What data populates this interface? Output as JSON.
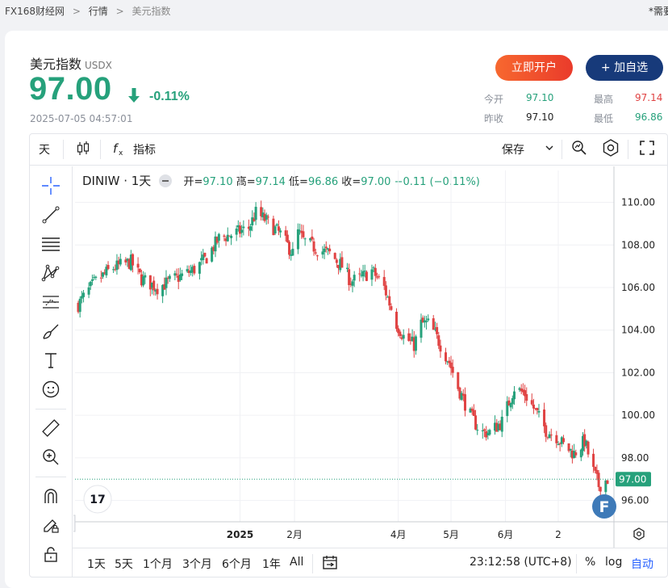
{
  "breadcrumb": {
    "home": "FX168财经网",
    "sep": ">",
    "section": "行情",
    "current": "美元指数",
    "right_text": "*需要"
  },
  "quote": {
    "name": "美元指数",
    "code": "USDX",
    "price": "97.00",
    "change_pct": "-0.11%",
    "direction": "down",
    "timestamp": "2025-07-05 04:57:01",
    "open_label": "今开",
    "open": "97.10",
    "high_label": "最高",
    "high": "97.14",
    "prev_label": "昨收",
    "prev": "97.10",
    "low_label": "最低",
    "low": "96.86"
  },
  "buttons": {
    "open_account": "立即开户",
    "add_watch": "+ 加自选"
  },
  "toolbar": {
    "interval": "天",
    "indicators": "指标",
    "save": "保存"
  },
  "legend": {
    "symbol": "DINIW · 1天",
    "open_label": "开",
    "open": "97.10",
    "high_label": "高",
    "high": "97.14",
    "low_label": "低",
    "low": "96.86",
    "close_label": "收",
    "close": "97.00",
    "change": "−0.11 (−0.11%)"
  },
  "bottombar": {
    "ranges": [
      "1天",
      "5天",
      "1个月",
      "3个月",
      "6个月",
      "1年",
      "All"
    ],
    "time": "23:12:58 (UTC+8)",
    "pct": "%",
    "log": "log",
    "auto": "自动"
  },
  "colors": {
    "up": "#26a17b",
    "down": "#e04343",
    "accent": "#2962ff",
    "brand_dark": "#173a7a"
  },
  "icons": [
    "crosshair-icon",
    "trend-line-icon",
    "fib-icon",
    "pattern-icon",
    "projection-icon",
    "brush-icon",
    "text-icon",
    "emoji-icon",
    "ruler-icon",
    "zoom-in-icon",
    "magnet-icon",
    "lock-draw-icon",
    "lock-icon",
    "candles-icon",
    "fx-icon",
    "camera-icon",
    "settings-icon",
    "fullscreen-icon",
    "tradingview-logo",
    "fx168-logo",
    "gear-icon",
    "calendar-range-icon"
  ],
  "chart_data": {
    "type": "candlestick",
    "symbol": "DINIW",
    "interval": "1天",
    "ylim": [
      95.0,
      111.5
    ],
    "yticks": [
      "110.00",
      "108.00",
      "106.00",
      "104.00",
      "102.00",
      "100.00",
      "98.00",
      "96.00"
    ],
    "xticks": [
      "2025",
      "2月",
      "4月",
      "5月",
      "6月",
      "2"
    ],
    "last_price_label": "97.00",
    "grid": true,
    "close_path": [
      [
        "2024-10-01",
        105.2
      ],
      [
        "2024-10-10",
        106.2
      ],
      [
        "2024-10-20",
        106.9
      ],
      [
        "2024-10-31",
        107.2
      ],
      [
        "2024-11-06",
        106.4
      ],
      [
        "2024-11-15",
        106.0
      ],
      [
        "2024-11-25",
        106.4
      ],
      [
        "2024-12-05",
        106.8
      ],
      [
        "2024-12-12",
        107.3
      ],
      [
        "2024-12-20",
        108.3
      ],
      [
        "2024-12-31",
        108.6
      ],
      [
        "2025-01-06",
        108.8
      ],
      [
        "2025-01-10",
        109.5
      ],
      [
        "2025-01-15",
        109.2
      ],
      [
        "2025-01-24",
        108.5
      ],
      [
        "2025-01-31",
        107.6
      ],
      [
        "2025-02-03",
        108.6
      ],
      [
        "2025-02-06",
        108.2
      ],
      [
        "2025-02-14",
        107.8
      ],
      [
        "2025-02-21",
        107.6
      ],
      [
        "2025-02-28",
        107.0
      ],
      [
        "2025-03-05",
        106.3
      ],
      [
        "2025-03-10",
        106.4
      ],
      [
        "2025-03-17",
        106.8
      ],
      [
        "2025-03-24",
        106.0
      ],
      [
        "2025-03-31",
        104.3
      ],
      [
        "2025-04-04",
        103.7
      ],
      [
        "2025-04-10",
        103.3
      ],
      [
        "2025-04-14",
        104.3
      ],
      [
        "2025-04-18",
        104.3
      ],
      [
        "2025-04-22",
        103.8
      ],
      [
        "2025-04-30",
        102.5
      ],
      [
        "2025-05-05",
        101.3
      ],
      [
        "2025-05-12",
        100.0
      ],
      [
        "2025-05-18",
        99.2
      ],
      [
        "2025-05-23",
        99.2
      ],
      [
        "2025-05-30",
        99.7
      ],
      [
        "2025-06-06",
        101.3
      ],
      [
        "2025-06-12",
        101.0
      ],
      [
        "2025-06-18",
        100.2
      ],
      [
        "2025-06-24",
        99.3
      ],
      [
        "2025-06-30",
        99.0
      ],
      [
        "2025-07-04",
        98.6
      ],
      [
        "2025-07-10",
        98.2
      ],
      [
        "2025-07-16",
        98.8
      ],
      [
        "2025-07-20",
        97.6
      ],
      [
        "2025-07-24",
        96.7
      ],
      [
        "2025-07-29",
        97.0
      ]
    ]
  }
}
